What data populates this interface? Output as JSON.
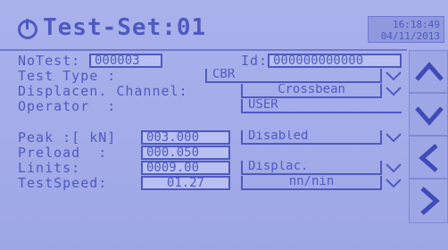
{
  "header": {
    "title": "Test-Set:01",
    "time": "16:18:49",
    "date": "04/11/2013"
  },
  "rows": [
    {
      "label": "NoTest:",
      "value": "000003",
      "id_label": "Id:",
      "id_value": "000000000000"
    },
    {
      "label": "Test Type :",
      "value": "CBR"
    },
    {
      "label": "Displacen. Channel:",
      "value": "Crossbean"
    },
    {
      "label": "Operator  :",
      "value": "USER"
    }
  ],
  "params": [
    {
      "label": "Peak :[ kN]",
      "value": "003.000",
      "option": "Disabled"
    },
    {
      "label": "Preload  :",
      "value": "000.050"
    },
    {
      "label": "Linits:",
      "value": "0009.00",
      "option": "Displac."
    },
    {
      "label": "TestSpeed:",
      "value": "01.27",
      "option": "nn/nin"
    }
  ],
  "icons": {
    "power": "power-icon",
    "dropdown": "chevron-down-icon",
    "nav_up": "chevron-up-icon",
    "nav_down": "chevron-down-icon",
    "nav_left": "chevron-left-icon",
    "nav_right": "chevron-right-icon"
  }
}
